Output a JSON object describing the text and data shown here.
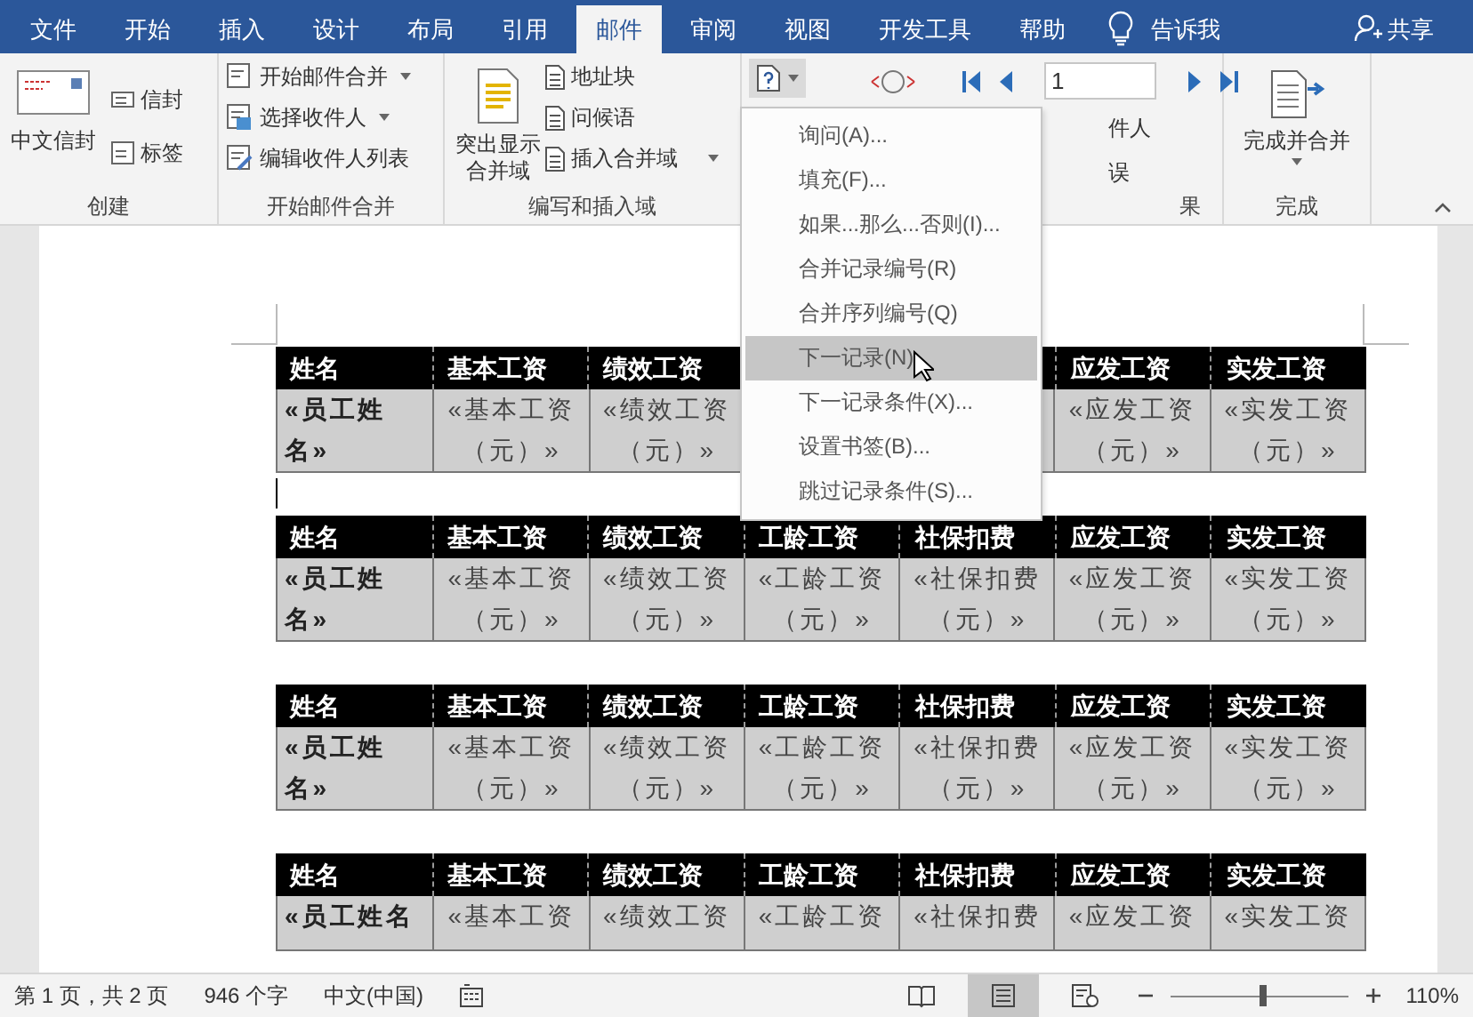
{
  "menu_tabs": [
    {
      "label": "文件",
      "selected": false
    },
    {
      "label": "开始",
      "selected": false
    },
    {
      "label": "插入",
      "selected": false
    },
    {
      "label": "设计",
      "selected": false
    },
    {
      "label": "布局",
      "selected": false
    },
    {
      "label": "引用",
      "selected": false
    },
    {
      "label": "邮件",
      "selected": true
    },
    {
      "label": "审阅",
      "selected": false
    },
    {
      "label": "视图",
      "selected": false
    },
    {
      "label": "开发工具",
      "selected": false
    },
    {
      "label": "帮助",
      "selected": false
    }
  ],
  "tell_me": "告诉我",
  "share": "共享",
  "ribbon": {
    "create": {
      "big": "中文信封",
      "items": [
        "信封",
        "标签"
      ],
      "label": "创建"
    },
    "start_merge": {
      "items": [
        {
          "label": "开始邮件合并",
          "dropdown": true
        },
        {
          "label": "选择收件人",
          "dropdown": true
        },
        {
          "label": "编辑收件人列表",
          "dropdown": false
        }
      ],
      "label": "开始邮件合并"
    },
    "write_insert": {
      "big_lines": [
        "突出显示",
        "合并域"
      ],
      "items": [
        {
          "label": "地址块",
          "dropdown": false
        },
        {
          "label": "问候语",
          "dropdown": false
        },
        {
          "label": "插入合并域",
          "dropdown": true
        }
      ],
      "label": "编写和插入域"
    },
    "preview": {
      "record": "1",
      "fragments": [
        "件人",
        "误"
      ],
      "label_fragment": "果"
    },
    "finish": {
      "button": "完成并合并",
      "label": "完成"
    }
  },
  "rules_menu": {
    "items": [
      {
        "label": "询问(A)...",
        "selected": false
      },
      {
        "label": "填充(F)...",
        "selected": false
      },
      {
        "label": "如果...那么...否则(I)...",
        "selected": false
      },
      {
        "label": "合并记录编号(R)",
        "selected": false
      },
      {
        "label": "合并序列编号(Q)",
        "selected": false
      },
      {
        "label": "下一记录(N)",
        "selected": true
      },
      {
        "label": "下一记录条件(X)...",
        "selected": false
      },
      {
        "label": "设置书签(B)...",
        "selected": false
      },
      {
        "label": "跳过记录条件(S)...",
        "selected": false
      }
    ]
  },
  "document": {
    "tables": [
      {
        "columns": [
          {
            "header": "姓名",
            "cell": "«员工姓名»"
          },
          {
            "header": "基本工资",
            "cell": "«基本工资（元）»"
          },
          {
            "header": "绩效工资",
            "cell": "«绩效工资（元）»"
          },
          {},
          {},
          {
            "header": "应发工资",
            "cell": "«应发工资（元）»"
          },
          {
            "header": "实发工资",
            "cell": "«实发工资（元）»"
          }
        ]
      },
      {
        "columns": [
          {
            "header": "姓名",
            "cell": "«员工姓名»"
          },
          {
            "header": "基本工资",
            "cell": "«基本工资（元）»"
          },
          {
            "header": "绩效工资",
            "cell": "«绩效工资（元）»"
          },
          {
            "header": "工龄工资",
            "cell": "«工龄工资（元）»"
          },
          {
            "header": "社保扣费",
            "cell": "«社保扣费（元）»"
          },
          {
            "header": "应发工资",
            "cell": "«应发工资（元）»"
          },
          {
            "header": "实发工资",
            "cell": "«实发工资（元）»"
          }
        ]
      },
      {
        "columns": [
          {
            "header": "姓名",
            "cell": "«员工姓名»"
          },
          {
            "header": "基本工资",
            "cell": "«基本工资（元）»"
          },
          {
            "header": "绩效工资",
            "cell": "«绩效工资（元）»"
          },
          {
            "header": "工龄工资",
            "cell": "«工龄工资（元）»"
          },
          {
            "header": "社保扣费",
            "cell": "«社保扣费（元）»"
          },
          {
            "header": "应发工资",
            "cell": "«应发工资（元）»"
          },
          {
            "header": "实发工资",
            "cell": "«实发工资（元）»"
          }
        ]
      },
      {
        "columns": [
          {
            "header": "姓名",
            "cell": "«员工姓名"
          },
          {
            "header": "基本工资",
            "cell": "«基本工资"
          },
          {
            "header": "绩效工资",
            "cell": "«绩效工资"
          },
          {
            "header": "工龄工资",
            "cell": "«工龄工资"
          },
          {
            "header": "社保扣费",
            "cell": "«社保扣费"
          },
          {
            "header": "应发工资",
            "cell": "«应发工资"
          },
          {
            "header": "实发工资",
            "cell": "«实发工资"
          }
        ]
      }
    ]
  },
  "status_bar": {
    "page": "第 1 页，共 2 页",
    "words": "946 个字",
    "language": "中文(中国)",
    "views": [
      {
        "kind": "read",
        "selected": false
      },
      {
        "kind": "print",
        "selected": true
      },
      {
        "kind": "web",
        "selected": false
      }
    ],
    "zoom": {
      "level": 0.52,
      "reading": "110%"
    }
  }
}
